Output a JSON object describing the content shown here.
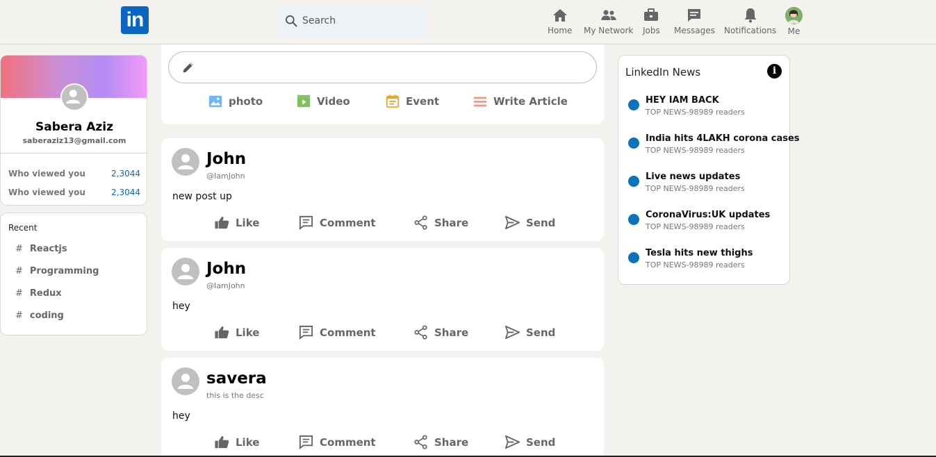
{
  "header": {
    "logo_text": "in",
    "search_placeholder": "Search",
    "nav": [
      {
        "label": "Home",
        "icon": "home-icon"
      },
      {
        "label": "My Network",
        "icon": "network-icon"
      },
      {
        "label": "Jobs",
        "icon": "briefcase-icon"
      },
      {
        "label": "Messages",
        "icon": "chat-icon"
      },
      {
        "label": "Notifications",
        "icon": "bell-icon"
      },
      {
        "label": "Me",
        "icon": "avatar"
      }
    ]
  },
  "profile": {
    "name": "Sabera Aziz",
    "email": "saberaziz13@gmail.com",
    "stats": [
      {
        "label": "Who viewed you",
        "value": "2,3044"
      },
      {
        "label": "Who viewed you",
        "value": "2,3044"
      }
    ]
  },
  "recent": {
    "title": "Recent",
    "hash": "#",
    "tags": [
      "Reactjs",
      "Programming",
      "Redux",
      "coding"
    ]
  },
  "composer": {
    "options": [
      {
        "label": "photo",
        "icon": "photo-icon",
        "color": "#70b5f9"
      },
      {
        "label": "Video",
        "icon": "video-icon",
        "color": "#7fc15e"
      },
      {
        "label": "Event",
        "icon": "calendar-icon",
        "color": "#e7a33e"
      },
      {
        "label": "Write Article",
        "icon": "article-icon",
        "color": "#f5987e"
      }
    ]
  },
  "post_actions": [
    "Like",
    "Comment",
    "Share",
    "Send"
  ],
  "posts": [
    {
      "name": "John",
      "desc": "@IamJohn",
      "message": "new post up"
    },
    {
      "name": "John",
      "desc": "@IamJohn",
      "message": "hey"
    },
    {
      "name": "savera",
      "desc": "this is the desc",
      "message": "hey"
    }
  ],
  "news": {
    "title": "LinkedIn News",
    "info_icon": "i",
    "items": [
      {
        "heading": "HEY IAM BACK",
        "sub": "TOP NEWS-98989 readers"
      },
      {
        "heading": "India hits 4LAKH corona cases",
        "sub": "TOP NEWS-98989 readers"
      },
      {
        "heading": "Live news updates",
        "sub": "TOP NEWS-98989 readers"
      },
      {
        "heading": "CoronaVirus:UK updates",
        "sub": "TOP NEWS-98989 readers"
      },
      {
        "heading": "Tesla hits new thighs",
        "sub": "TOP NEWS-98989 readers"
      }
    ]
  },
  "colors": {
    "brand": "#0a66c2",
    "news_dot": "#0a73bc",
    "background": "#f3f2ef"
  }
}
